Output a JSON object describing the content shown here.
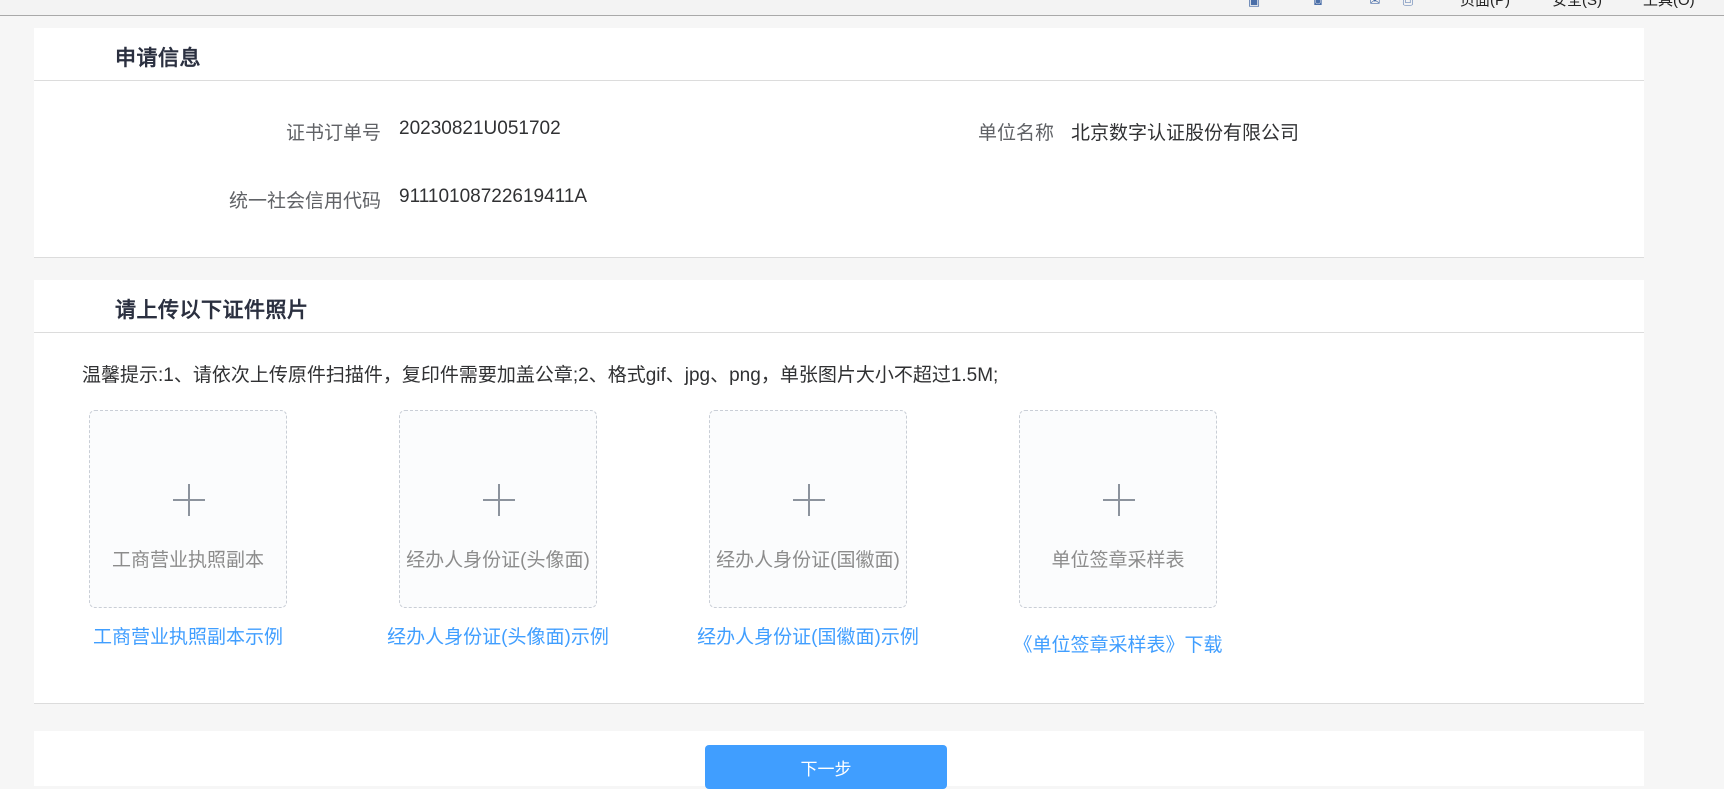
{
  "browser_toolbar": {
    "menu_page": "页面(P)",
    "menu_safety": "安全(S)",
    "menu_tools": "工具(O)",
    "icons": [
      "home-icon",
      "rss-feed-icon",
      "mail-icon",
      "print-icon"
    ]
  },
  "application_info": {
    "title": "申请信息",
    "order_number_label": "证书订单号",
    "order_number_value": "20230821U051702",
    "company_name_label": "单位名称",
    "company_name_value": "北京数字认证股份有限公司",
    "credit_code_label": "统一社会信用代码",
    "credit_code_value": "91110108722619411A"
  },
  "upload_section": {
    "title": "请上传以下证件照片",
    "notice": "温馨提示:1、请依次上传原件扫描件，复印件需要加盖公章;2、格式gif、jpg、png，单张图片大小不超过1.5M;",
    "items": [
      {
        "label": "工商营业执照副本",
        "example": "工商营业执照副本示例"
      },
      {
        "label": "经办人身份证(头像面)",
        "example": "经办人身份证(头像面)示例"
      },
      {
        "label": "经办人身份证(国徽面)",
        "example": "经办人身份证(国徽面)示例"
      },
      {
        "label": "单位签章采样表",
        "example": "《单位签章采样表》下载"
      }
    ]
  },
  "actions": {
    "next_label": "下一步"
  },
  "colors": {
    "accent": "#409eff",
    "background": "#f6f6f6",
    "panel": "#ffffff"
  }
}
